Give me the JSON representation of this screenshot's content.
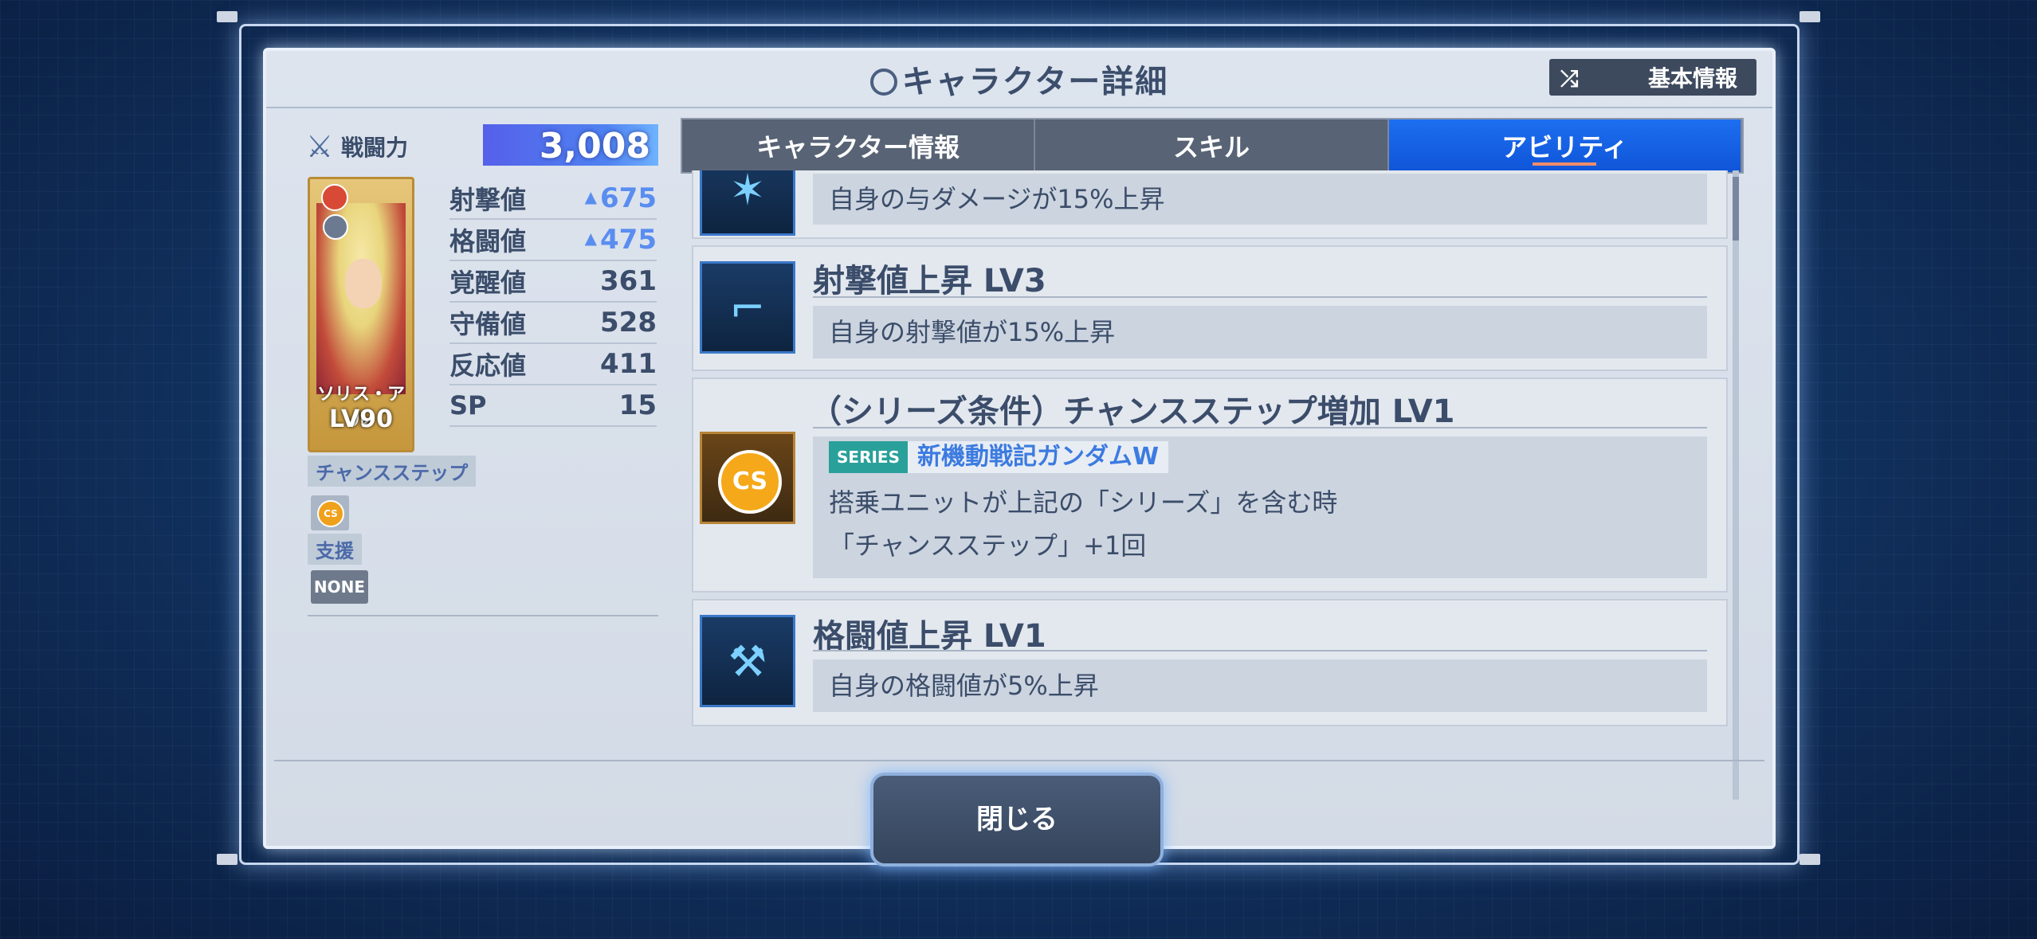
{
  "header": {
    "title": "キャラクター詳細",
    "basic_info_button": "基本情報"
  },
  "left": {
    "power_label": "戦闘力",
    "power_value": "3,008",
    "card": {
      "name": "ソリス・アル",
      "level": "LV90"
    },
    "stats": [
      {
        "label": "射撃値",
        "value": "675",
        "boosted": true
      },
      {
        "label": "格闘値",
        "value": "475",
        "boosted": true
      },
      {
        "label": "覚醒値",
        "value": "361",
        "boosted": false
      },
      {
        "label": "守備値",
        "value": "528",
        "boosted": false
      },
      {
        "label": "反応値",
        "value": "411",
        "boosted": false
      },
      {
        "label": "SP",
        "value": "15",
        "boosted": false
      }
    ],
    "chance_step_label": "チャンスステップ",
    "chance_step_icon": "CS",
    "support_label": "支援",
    "support_value": "NONE"
  },
  "tabs": [
    {
      "label": "キャラクター情報",
      "active": false
    },
    {
      "label": "スキル",
      "active": false
    },
    {
      "label": "アビリティ",
      "active": true
    }
  ],
  "abilities": [
    {
      "title": "",
      "desc": "自身の与ダメージが15%上昇",
      "icon": "armor-icon"
    },
    {
      "title": "射撃値上昇 LV3",
      "desc": "自身の射撃値が15%上昇",
      "icon": "rifle-icon"
    },
    {
      "title": "（シリーズ条件）チャンスステップ増加 LV1",
      "series_tag": "SERIES",
      "series_name": "新機動戦記ガンダムW",
      "desc_line1": "搭乗ユニットが上記の「シリーズ」を含む時",
      "desc_line2": "「チャンスステップ」+1回",
      "icon": "CS"
    },
    {
      "title": "格闘値上昇 LV1",
      "desc": "自身の格闘値が5%上昇",
      "icon": "axe-icon"
    }
  ],
  "close_button": "閉じる",
  "colors": {
    "accent_blue": "#1d6ef0",
    "power_bar": "#5560ea",
    "boost_text": "#5a8df0"
  }
}
